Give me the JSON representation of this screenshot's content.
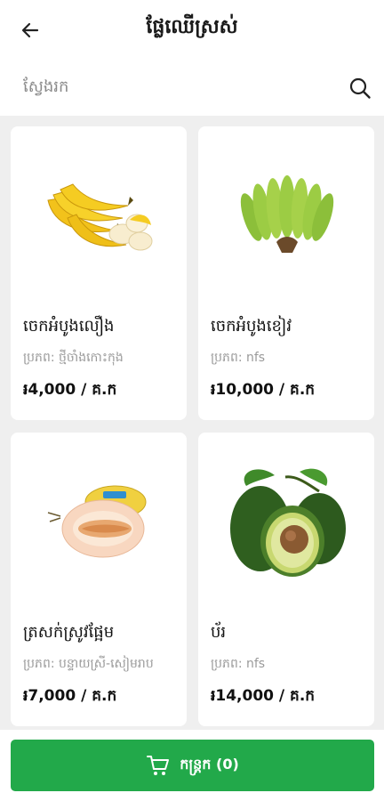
{
  "header": {
    "title": "ផ្លែឈើស្រស់",
    "back_icon": "arrow-left-icon"
  },
  "search": {
    "placeholder": "ស្វែងរក",
    "icon": "search-icon"
  },
  "products": [
    {
      "name": "ចេកអំបូងលឿង",
      "origin": "ប្រភព: ថ្មីចាំងកោះកុង",
      "price": "៛4,000 / គ.ក",
      "image": "yellow-banana-image"
    },
    {
      "name": "ចេកអំបូងខៀវ",
      "origin": "ប្រភព: nfs",
      "price": "៛10,000 / គ.ក",
      "image": "green-banana-image"
    },
    {
      "name": "ត្រសក់ស្រូវផ្អែម",
      "origin": "ប្រភព: បន្ទាយស្រី-សៀមរាប",
      "price": "៛7,000 / គ.ក",
      "image": "melon-image"
    },
    {
      "name": "ប័រ",
      "origin": "ប្រភព: nfs",
      "price": "៛14,000 / គ.ក",
      "image": "avocado-image"
    }
  ],
  "cart": {
    "label": "កន្ត្រក (0)",
    "icon": "cart-icon",
    "color": "#22a94a"
  }
}
